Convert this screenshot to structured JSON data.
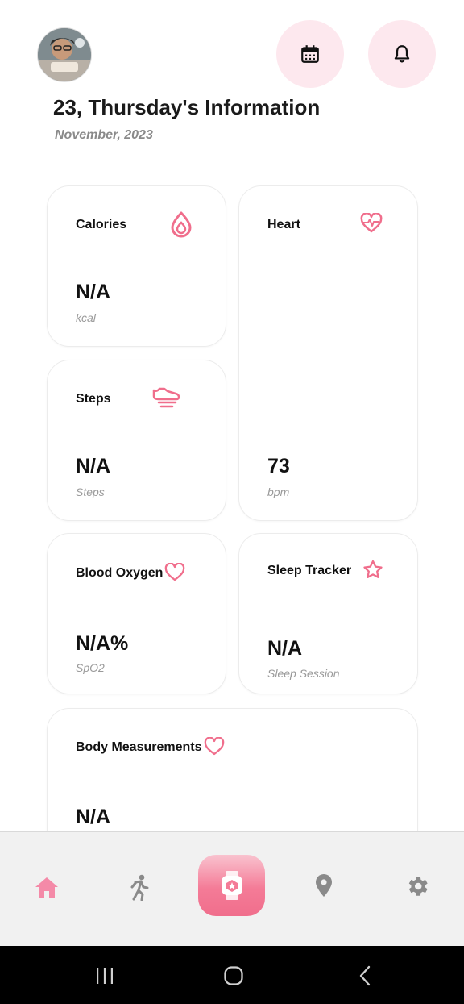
{
  "header": {
    "title": "23, Thursday's Information",
    "subtitle": "November, 2023",
    "avatar_icon": "user-avatar",
    "calendar_icon": "calendar-icon",
    "bell_icon": "bell-icon"
  },
  "cards": {
    "calories": {
      "label": "Calories",
      "value": "N/A",
      "unit": "kcal",
      "icon": "drop-icon"
    },
    "heart": {
      "label": "Heart",
      "value": "73",
      "unit": "bpm",
      "icon": "heart-pulse-icon"
    },
    "steps": {
      "label": "Steps",
      "value": "N/A",
      "unit": "Steps",
      "icon": "shoe-icon"
    },
    "blood_oxygen": {
      "label": "Blood Oxygen",
      "value": "N/A%",
      "unit": "SpO2",
      "icon": "heart-outline-icon"
    },
    "sleep": {
      "label": "Sleep Tracker",
      "value": "N/A",
      "unit": "Sleep Session",
      "icon": "star-outline-icon"
    },
    "body": {
      "label": "Body Measurements",
      "value": "N/A",
      "icon": "heart-outline-icon"
    }
  },
  "bottom_nav": {
    "items": [
      "home-icon",
      "run-icon",
      "watch-icon",
      "location-pin-icon",
      "settings-gear-icon"
    ],
    "active": "home-icon"
  },
  "system_nav": [
    "recents-icon",
    "home-circle-icon",
    "back-icon"
  ],
  "colors": {
    "accent": "#f06e8c",
    "accent_soft": "#fde8ee",
    "nav_active": "#f48aa8",
    "nav_inactive": "#8a8a8a"
  }
}
